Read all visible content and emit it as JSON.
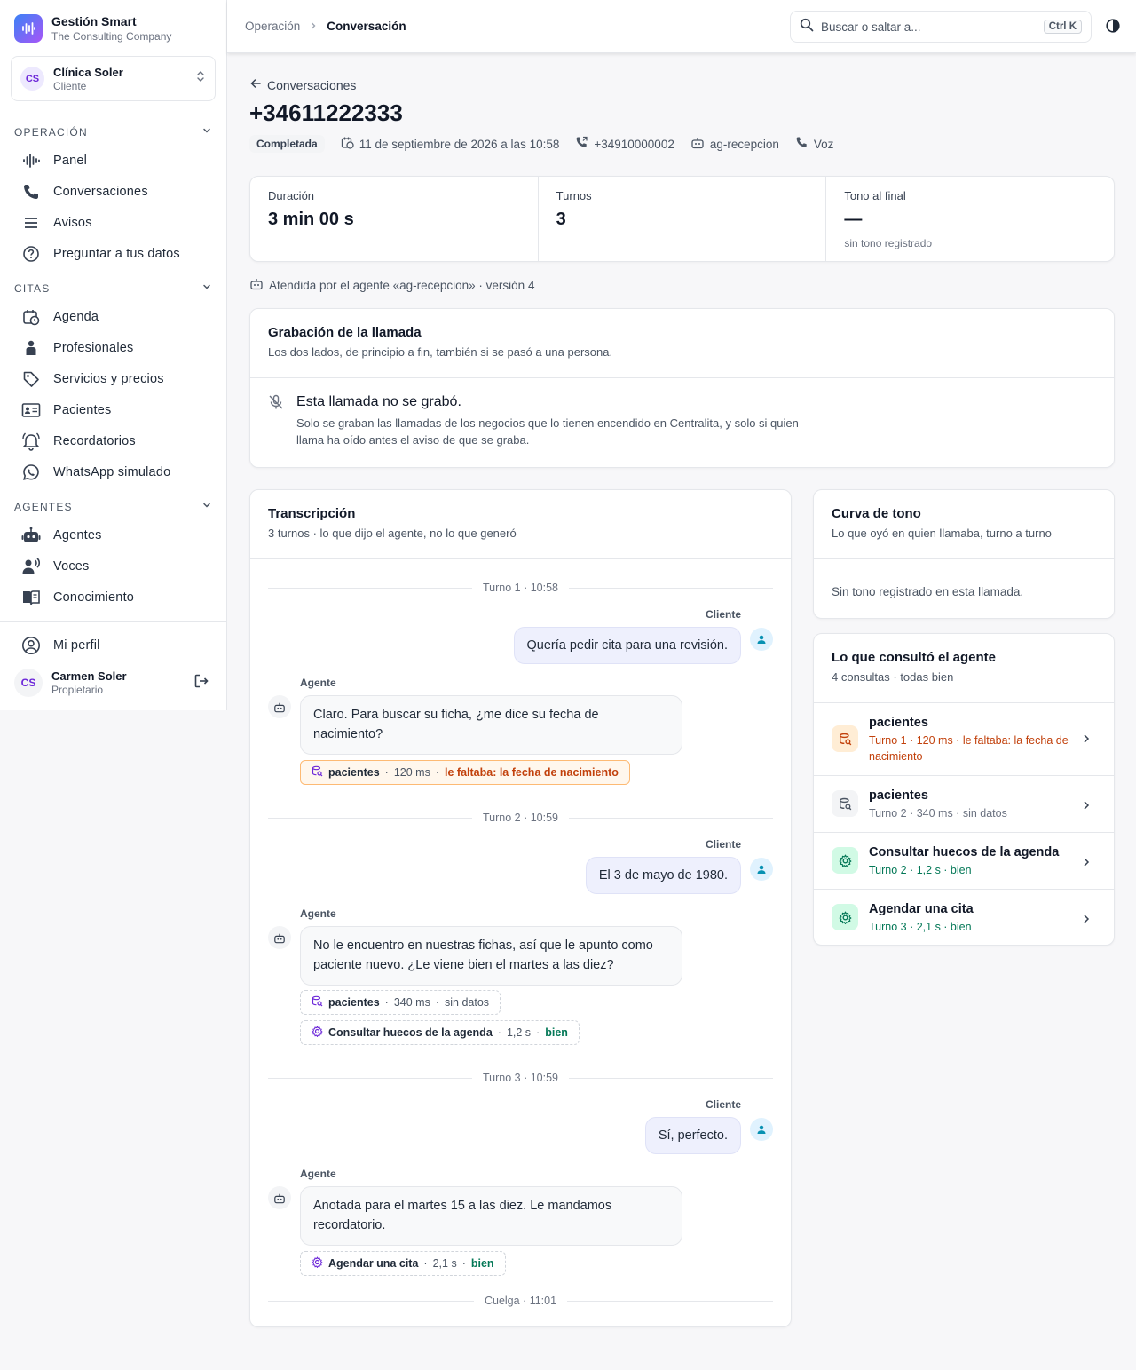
{
  "brand": {
    "title": "Gestión Smart",
    "subtitle": "The Consulting Company"
  },
  "tenant": {
    "initials": "CS",
    "name": "Clínica Soler",
    "role": "Cliente"
  },
  "nav": {
    "sections": [
      {
        "label": "OPERACIÓN",
        "items": [
          {
            "label": "Panel",
            "icon": "waveform-icon"
          },
          {
            "label": "Conversaciones",
            "icon": "phone-icon"
          },
          {
            "label": "Avisos",
            "icon": "list-icon"
          },
          {
            "label": "Preguntar a tus datos",
            "icon": "question-bubble-icon"
          }
        ]
      },
      {
        "label": "CITAS",
        "items": [
          {
            "label": "Agenda",
            "icon": "calendar-clock-icon"
          },
          {
            "label": "Profesionales",
            "icon": "person-icon"
          },
          {
            "label": "Servicios y precios",
            "icon": "tag-icon"
          },
          {
            "label": "Pacientes",
            "icon": "id-card-icon"
          },
          {
            "label": "Recordatorios",
            "icon": "bell-icon"
          },
          {
            "label": "WhatsApp simulado",
            "icon": "whatsapp-icon"
          }
        ]
      },
      {
        "label": "AGENTES",
        "items": [
          {
            "label": "Agentes",
            "icon": "robot-icon"
          },
          {
            "label": "Voces",
            "icon": "voice-icon"
          },
          {
            "label": "Conocimiento",
            "icon": "book-icon"
          }
        ]
      }
    ]
  },
  "profile": {
    "label": "Mi perfil"
  },
  "user": {
    "initials": "CS",
    "name": "Carmen Soler",
    "role": "Propietario"
  },
  "topbar": {
    "breadcrumb_parent": "Operación",
    "breadcrumb_current": "Conversación",
    "search_placeholder": "Buscar o saltar a...",
    "search_shortcut": "Ctrl K"
  },
  "page": {
    "back_label": "Conversaciones",
    "title": "+34611222333",
    "status": "Completada",
    "date": "11 de septiembre de 2026 a las 10:58",
    "callee": "+34910000002",
    "agent": "ag-recepcion",
    "channel": "Voz"
  },
  "stats": {
    "duration_label": "Duración",
    "duration_value": "3 min 00 s",
    "turns_label": "Turnos",
    "turns_value": "3",
    "tone_label": "Tono al final",
    "tone_value": "—",
    "tone_sub": "sin tono registrado"
  },
  "attended": "Atendida por el agente «ag-recepcion» · versión 4",
  "recording": {
    "title": "Grabación de la llamada",
    "subtitle": "Los dos lados, de principio a fin, también si se pasó a una persona.",
    "empty_title": "Esta llamada no se grabó.",
    "empty_text": "Solo se graban las llamadas de los negocios que lo tienen encendido en Centralita, y solo si quien llama ha oído antes el aviso de que se graba."
  },
  "transcript": {
    "title": "Transcripción",
    "subtitle": "3 turnos · lo que dijo el agente, no lo que generó",
    "client_label": "Cliente",
    "agent_label": "Agente",
    "turns": [
      {
        "divider": "Turno 1 · 10:58",
        "client": "Quería pedir cita para una revisión.",
        "agent": "Claro. Para buscar su ficha, ¿me dice su fecha de nacimiento?",
        "tools": [
          {
            "name": "pacientes",
            "time": "120 ms",
            "result": "le faltaba: la fecha de nacimiento",
            "status": "warn"
          }
        ]
      },
      {
        "divider": "Turno 2 · 10:59",
        "client": "El 3 de mayo de 1980.",
        "agent": "No le encuentro en nuestras fichas, así que le apunto como paciente nuevo. ¿Le viene bien el martes a las diez?",
        "tools": [
          {
            "name": "pacientes",
            "time": "340 ms",
            "result": "sin datos",
            "status": "empty"
          },
          {
            "name": "Consultar huecos de la agenda",
            "time": "1,2 s",
            "result": "bien",
            "status": "ok"
          }
        ]
      },
      {
        "divider": "Turno 3 · 10:59",
        "client": "Sí, perfecto.",
        "agent": "Anotada para el martes 15 a las diez. Le mandamos recordatorio.",
        "tools": [
          {
            "name": "Agendar una cita",
            "time": "2,1 s",
            "result": "bien",
            "status": "ok"
          }
        ]
      }
    ],
    "end": "Cuelga · 11:01"
  },
  "tone_curve": {
    "title": "Curva de tono",
    "subtitle": "Lo que oyó en quien llamaba, turno a turno",
    "empty": "Sin tono registrado en esta llamada."
  },
  "consults": {
    "title": "Lo que consultó el agente",
    "subtitle": "4 consultas · todas bien",
    "items": [
      {
        "name": "pacientes",
        "detail": "Turno 1 · 120 ms · le faltaba: la fecha de nacimiento",
        "status": "warn"
      },
      {
        "name": "pacientes",
        "detail": "Turno 2 · 340 ms · sin datos",
        "status": "empty"
      },
      {
        "name": "Consultar huecos de la agenda",
        "detail": "Turno 2 · 1,2 s · bien",
        "status": "ok"
      },
      {
        "name": "Agendar una cita",
        "detail": "Turno 3 · 2,1 s · bien",
        "status": "ok"
      }
    ]
  },
  "colors": {
    "accent": "#6d28d9",
    "ok": "#047857",
    "warn": "#c2410c",
    "warn_bg": "#fff7ed"
  }
}
